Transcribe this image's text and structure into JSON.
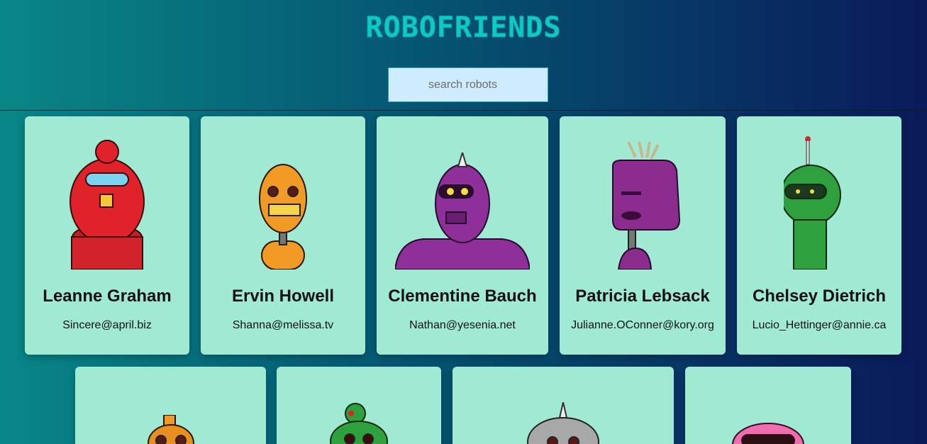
{
  "header": {
    "title": "ROBOFRIENDS"
  },
  "search": {
    "placeholder": "search robots"
  },
  "robots": [
    {
      "name": "Leanne Graham",
      "email": "Sincere@april.biz",
      "color": "#e0222b"
    },
    {
      "name": "Ervin Howell",
      "email": "Shanna@melissa.tv",
      "color": "#f29a26"
    },
    {
      "name": "Clementine Bauch",
      "email": "Nathan@yesenia.net",
      "color": "#8e2f9a"
    },
    {
      "name": "Patricia Lebsack",
      "email": "Julianne.OConner@kory.org",
      "color": "#8b2c8e"
    },
    {
      "name": "Chelsey Dietrich",
      "email": "Lucio_Hettinger@annie.ca",
      "color": "#2ea03d"
    },
    {
      "color": "#e8901f"
    },
    {
      "color": "#2ea03d"
    },
    {
      "color": "#a8a8a8"
    },
    {
      "color": "#f06db0"
    }
  ]
}
